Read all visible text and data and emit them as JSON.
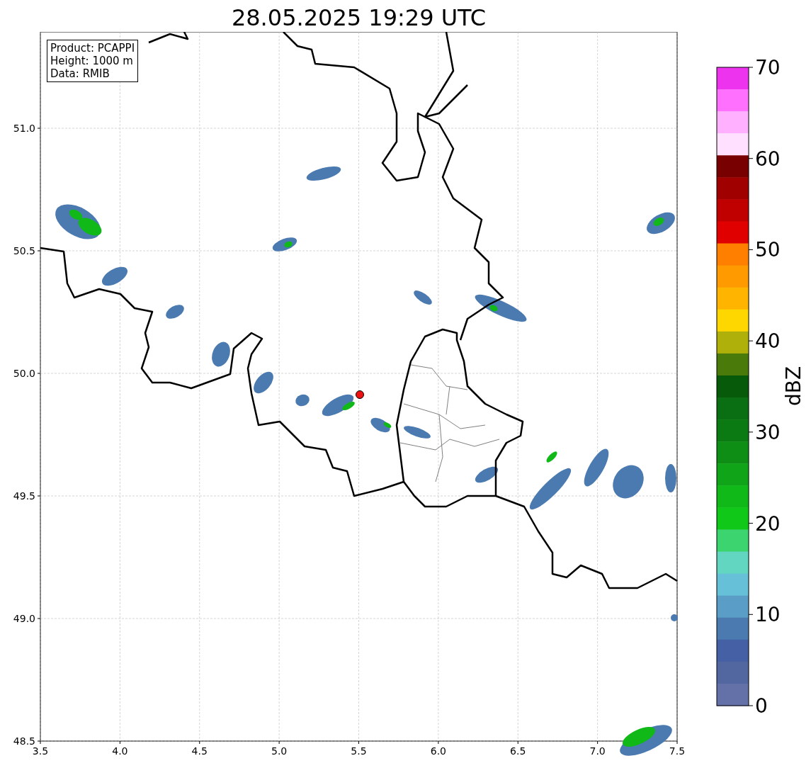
{
  "title": "28.05.2025 19:29 UTC",
  "info_box": [
    "Product: PCAPPI",
    "Height: 1000 m",
    "Data: RMIB"
  ],
  "map": {
    "x_ticks": [
      "3.5",
      "4.0",
      "4.5",
      "5.0",
      "5.5",
      "6.0",
      "6.5",
      "7.0",
      "7.5"
    ],
    "y_ticks": [
      "51.0",
      "50.5",
      "50.0",
      "49.5",
      "49.0",
      "48.5"
    ]
  },
  "colorbar": {
    "label": "dBZ",
    "ticks": [
      "70",
      "60",
      "50",
      "40",
      "30",
      "20",
      "10",
      "0"
    ],
    "bands": [
      {
        "color": "#ee33ee"
      },
      {
        "color": "#ff70ff"
      },
      {
        "color": "#ffb0ff"
      },
      {
        "color": "#ffe0ff"
      },
      {
        "color": "#780000"
      },
      {
        "color": "#a00000"
      },
      {
        "color": "#c00000"
      },
      {
        "color": "#e00000"
      },
      {
        "color": "#ff7f00"
      },
      {
        "color": "#ff9a00"
      },
      {
        "color": "#ffb400"
      },
      {
        "color": "#ffd700"
      },
      {
        "color": "#b0b00a"
      },
      {
        "color": "#4a7a0a"
      },
      {
        "color": "#065a0a"
      },
      {
        "color": "#0a6e12"
      },
      {
        "color": "#0c7a12"
      },
      {
        "color": "#0e8e14"
      },
      {
        "color": "#10a418"
      },
      {
        "color": "#10b818"
      },
      {
        "color": "#10c818"
      },
      {
        "color": "#3cd46e"
      },
      {
        "color": "#62d6c0"
      },
      {
        "color": "#66c0d8"
      },
      {
        "color": "#5a9ec8"
      },
      {
        "color": "#4a7ab0"
      },
      {
        "color": "#4560a5"
      },
      {
        "color": "#5266a0"
      },
      {
        "color": "#6470a8"
      }
    ]
  }
}
